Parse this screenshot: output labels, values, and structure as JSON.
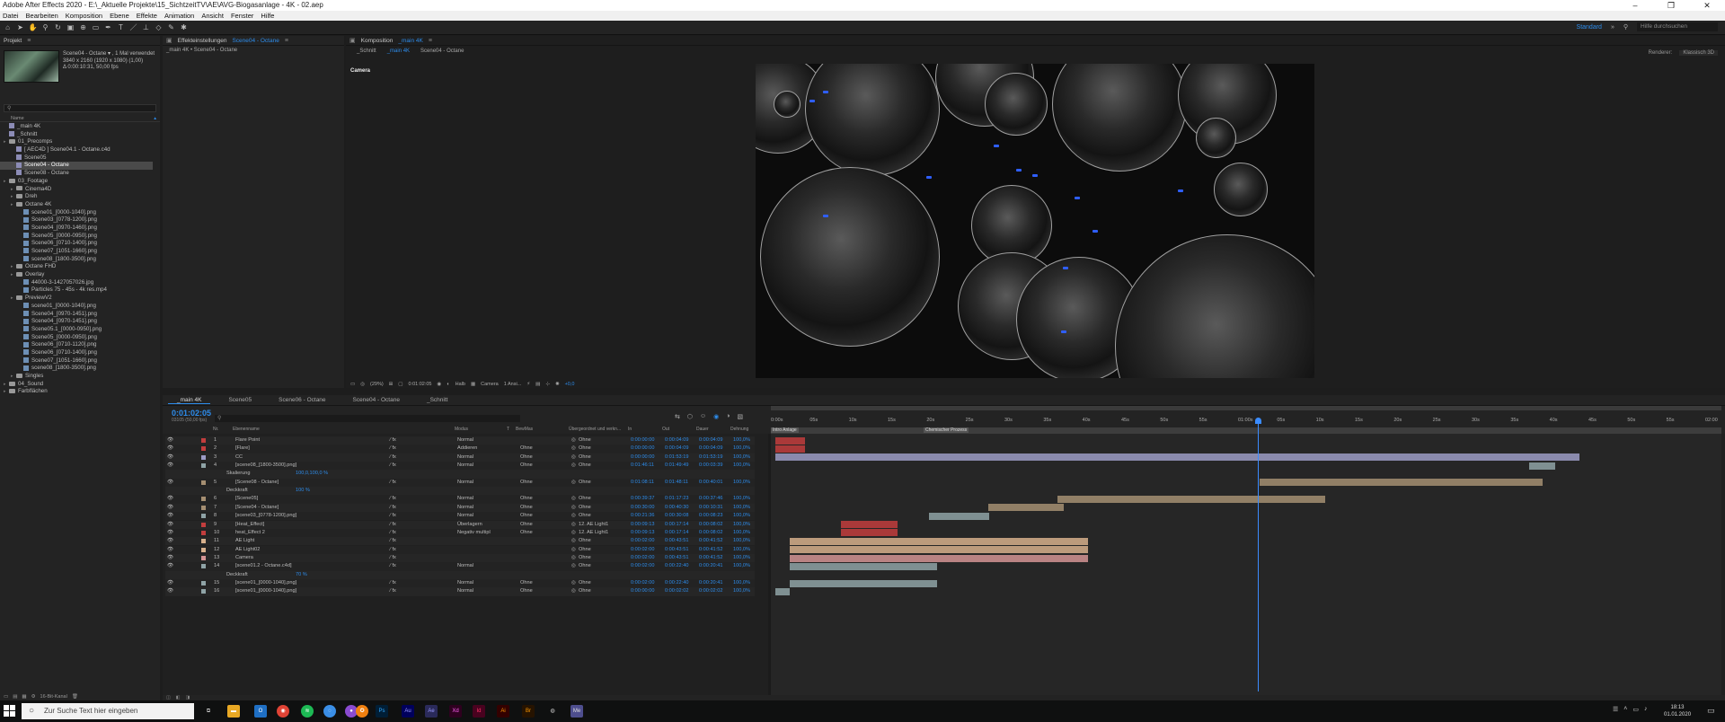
{
  "window": {
    "title": "Adobe After Effects 2020 - E:\\_Aktuelle Projekte\\15_SichtzeitTV\\AE\\AVG-Biogasanlage - 4K - 02.aep",
    "controls": [
      "–",
      "❐",
      "✕"
    ]
  },
  "menu": [
    "Datei",
    "Bearbeiten",
    "Komposition",
    "Ebene",
    "Effekte",
    "Animation",
    "Ansicht",
    "Fenster",
    "Hilfe"
  ],
  "toolbar": {
    "workspace_active": "Standard",
    "search_help": "Hilfe durchsuchen"
  },
  "project": {
    "tab": "Projekt",
    "preview_name": "Scene04 - Octane",
    "preview_used": ", 1 Mal verwendet",
    "preview_info1": "3840 x 2160 (1920 x 1080) (1,00)",
    "preview_info2": "Δ 0:00:10:31, 50,00 fps",
    "col_name": "Name",
    "items": [
      {
        "label": "_main 4K",
        "type": "comp",
        "indent": 0
      },
      {
        "label": "_Schnitt",
        "type": "comp",
        "indent": 0
      },
      {
        "label": "01_Precomps",
        "type": "folder",
        "indent": 0
      },
      {
        "label": "[ AEC4D ] Scene04.1 - Octane.c4d",
        "type": "comp",
        "indent": 1
      },
      {
        "label": "Scene05",
        "type": "comp",
        "indent": 1
      },
      {
        "label": "Scene04 - Octane",
        "type": "comp",
        "indent": 1,
        "selected": true
      },
      {
        "label": "Scene08 - Octane",
        "type": "comp",
        "indent": 1
      },
      {
        "label": "03_Footage",
        "type": "folder",
        "indent": 0
      },
      {
        "label": "Cinema4D",
        "type": "folder",
        "indent": 1
      },
      {
        "label": "Dreh",
        "type": "folder",
        "indent": 1
      },
      {
        "label": "Octane 4K",
        "type": "folder",
        "indent": 1
      },
      {
        "label": "scene01_[0000-1040].png",
        "type": "file",
        "indent": 2
      },
      {
        "label": "Scene03_[0778-1200].png",
        "type": "file",
        "indent": 2
      },
      {
        "label": "Scene04_[0970-1460].png",
        "type": "file",
        "indent": 2
      },
      {
        "label": "Scene05_[0000-0950].png",
        "type": "file",
        "indent": 2
      },
      {
        "label": "Scene06_[0710-1400].png",
        "type": "file",
        "indent": 2
      },
      {
        "label": "Scene07_[1051-1660].png",
        "type": "file",
        "indent": 2
      },
      {
        "label": "scene08_[1800-3500].png",
        "type": "file",
        "indent": 2
      },
      {
        "label": "Octane FHD",
        "type": "folder",
        "indent": 1
      },
      {
        "label": "Overlay",
        "type": "folder",
        "indent": 1
      },
      {
        "label": "44000-3-1427057026.jpg",
        "type": "file",
        "indent": 2
      },
      {
        "label": "Particles 75 - 45s - 4k res.mp4",
        "type": "file",
        "indent": 2
      },
      {
        "label": "PreviewV2",
        "type": "folder",
        "indent": 1
      },
      {
        "label": "scene01_[0000-1040].png",
        "type": "file",
        "indent": 2
      },
      {
        "label": "Scene04_[0970-1451].png",
        "type": "file",
        "indent": 2
      },
      {
        "label": "Scene04_[0970-1451].png",
        "type": "file",
        "indent": 2
      },
      {
        "label": "Scene05.1_[0000-0950].png",
        "type": "file",
        "indent": 2
      },
      {
        "label": "Scene05_[0000-0950].png",
        "type": "file",
        "indent": 2
      },
      {
        "label": "Scene06_[0710-1120].png",
        "type": "file",
        "indent": 2
      },
      {
        "label": "Scene06_[0710-1400].png",
        "type": "file",
        "indent": 2
      },
      {
        "label": "Scene07_[1051-1660].png",
        "type": "file",
        "indent": 2
      },
      {
        "label": "scene08_[1800-3500].png",
        "type": "file",
        "indent": 2
      },
      {
        "label": "Singles",
        "type": "folder",
        "indent": 1
      },
      {
        "label": "04_Sound",
        "type": "folder",
        "indent": 0
      },
      {
        "label": "Farbflächen",
        "type": "folder",
        "indent": 0
      }
    ],
    "bit_depth": "16-Bit-Kanal"
  },
  "effects": {
    "tab_label": "Effekteinstellungen",
    "tab_target": "Scene04 - Octane",
    "breadcrumb": "_main 4K • Scene04 - Octane"
  },
  "composition": {
    "tab_label": "Komposition",
    "tab_target": "_main 4K",
    "subtabs": [
      "_Schnitt",
      "_main 4K",
      "Scene04 - Octane"
    ],
    "renderer_label": "Renderer:",
    "renderer_value": "Klassisch 3D",
    "camera_label": "Camera",
    "footer": {
      "zoom": "(29%)",
      "time": "0:01:02:05",
      "quality": "Halb",
      "camera": "Camera",
      "views": "1 Ansi...",
      "offset": "+0,0"
    }
  },
  "timeline": {
    "tabs": [
      "_main 4K",
      "Scene05",
      "Scene06 - Octane",
      "Scene04 - Octane",
      "_Schnitt"
    ],
    "current_time": "0:01:02:05",
    "current_frames": "03105 (50,00 fps)",
    "headers": {
      "nr": "Nr.",
      "name": "Ebenenname",
      "mode": "Modus",
      "t": "T",
      "trkmat": "BewMas",
      "parent": "Übergeordnet und verkn...",
      "in": "In",
      "out": "Out",
      "dur": "Dauer",
      "stretch": "Dehnung"
    },
    "ruler": [
      "0:00s",
      "05s",
      "10s",
      "15s",
      "20s",
      "25s",
      "30s",
      "35s",
      "40s",
      "45s",
      "50s",
      "55s",
      "01:00s",
      "05s",
      "10s",
      "15s",
      "20s",
      "25s",
      "30s",
      "35s",
      "40s",
      "45s",
      "50s",
      "55s",
      "02:00"
    ],
    "markers": [
      "Intro Anlage",
      "Chemischer Prozess"
    ],
    "layers": [
      {
        "nr": "1",
        "name": "Flare Point",
        "mode": "Normal",
        "trk": "",
        "parent": "Ohne",
        "in": "0:00:00:00",
        "out": "0:00:04:09",
        "dur": "0:00:04:09",
        "st": "100,0%",
        "color": "#c23d3d"
      },
      {
        "nr": "2",
        "name": "[Flare]",
        "mode": "Addieren",
        "trk": "Ohne",
        "parent": "Ohne",
        "in": "0:00:00:00",
        "out": "0:00:04:09",
        "dur": "0:00:04:09",
        "st": "100,0%",
        "color": "#c23d3d"
      },
      {
        "nr": "3",
        "name": "CC",
        "mode": "Normal",
        "trk": "Ohne",
        "parent": "Ohne",
        "in": "0:00:00:00",
        "out": "0:01:53:19",
        "dur": "0:01:53:19",
        "st": "100,0%",
        "color": "#9c9cc6"
      },
      {
        "nr": "4",
        "name": "[scene08_[1800-3500].png]",
        "mode": "Normal",
        "trk": "Ohne",
        "parent": "Ohne",
        "in": "0:01:46:11",
        "out": "0:01:49:49",
        "dur": "0:00:03:39",
        "st": "100,0%",
        "color": "#8fa3a6"
      },
      {
        "nr": "",
        "name": "Skalierung",
        "value": "100,0,100,0 %",
        "prop": true
      },
      {
        "nr": "5",
        "name": "[Scene08 - Octane]",
        "mode": "Normal",
        "trk": "Ohne",
        "parent": "Ohne",
        "in": "0:01:08:11",
        "out": "0:01:48:11",
        "dur": "0:00:40:01",
        "st": "100,0%",
        "color": "#a58f72"
      },
      {
        "nr": "",
        "name": "Deckkraft",
        "value": "100 %",
        "prop": true
      },
      {
        "nr": "6",
        "name": "[Scene05]",
        "mode": "Normal",
        "trk": "Ohne",
        "parent": "Ohne",
        "in": "0:00:39:37",
        "out": "0:01:17:23",
        "dur": "0:00:37:46",
        "st": "100,0%",
        "color": "#a58f72"
      },
      {
        "nr": "7",
        "name": "[Scene04 - Octane]",
        "mode": "Normal",
        "trk": "Ohne",
        "parent": "Ohne",
        "in": "0:00:30:00",
        "out": "0:00:40:30",
        "dur": "0:00:10:31",
        "st": "100,0%",
        "color": "#a58f72"
      },
      {
        "nr": "8",
        "name": "[scene03_[0778-1200].png]",
        "mode": "Normal",
        "trk": "Ohne",
        "parent": "Ohne",
        "in": "0:00:21:36",
        "out": "0:00:30:08",
        "dur": "0:00:08:23",
        "st": "100,0%",
        "color": "#8fa3a6"
      },
      {
        "nr": "9",
        "name": "[Heat_Effect]",
        "mode": "Überlagern",
        "trk": "Ohne",
        "parent": "12. AE Light1",
        "in": "0:00:09:13",
        "out": "0:00:17:14",
        "dur": "0:00:08:02",
        "st": "100,0%",
        "color": "#c23d3d"
      },
      {
        "nr": "10",
        "name": "heat_Effect 2",
        "mode": "Negativ multipl",
        "trk": "Ohne",
        "parent": "12. AE Light1",
        "in": "0:00:09:13",
        "out": "0:00:17:14",
        "dur": "0:00:08:02",
        "st": "100,0%",
        "color": "#c23d3d"
      },
      {
        "nr": "11",
        "name": "AE Light",
        "mode": "",
        "trk": "",
        "parent": "Ohne",
        "in": "0:00:02:00",
        "out": "0:00:43:51",
        "dur": "0:00:41:52",
        "st": "100,0%",
        "color": "#d7b08c"
      },
      {
        "nr": "12",
        "name": "AE Light02",
        "mode": "",
        "trk": "",
        "parent": "Ohne",
        "in": "0:00:02:00",
        "out": "0:00:43:51",
        "dur": "0:00:41:52",
        "st": "100,0%",
        "color": "#d7b08c"
      },
      {
        "nr": "13",
        "name": "Camera",
        "mode": "",
        "trk": "",
        "parent": "Ohne",
        "in": "0:00:02:00",
        "out": "0:00:43:51",
        "dur": "0:00:41:52",
        "st": "100,0%",
        "color": "#d49494"
      },
      {
        "nr": "14",
        "name": "[scene01.2 - Octane.c4d]",
        "mode": "Normal",
        "trk": "",
        "parent": "Ohne",
        "in": "0:00:02:00",
        "out": "0:00:22:40",
        "dur": "0:00:20:41",
        "st": "100,0%",
        "color": "#8fa3a6"
      },
      {
        "nr": "",
        "name": "Deckkraft",
        "value": "70 %",
        "prop": true
      },
      {
        "nr": "15",
        "name": "[scene01_[0000-1040].png]",
        "mode": "Normal",
        "trk": "Ohne",
        "parent": "Ohne",
        "in": "0:00:02:00",
        "out": "0:00:22:40",
        "dur": "0:00:20:41",
        "st": "100,0%",
        "color": "#8fa3a6"
      },
      {
        "nr": "16",
        "name": "[scene01_[0000-1040].png]",
        "mode": "Normal",
        "trk": "Ohne",
        "parent": "Ohne",
        "in": "0:00:00:00",
        "out": "0:00:02:02",
        "dur": "0:00:02:02",
        "st": "100,0%",
        "color": "#8fa3a6"
      }
    ]
  },
  "taskbar": {
    "search_placeholder": "Zur Suche Text hier eingeben",
    "time": "18:13",
    "date": "01.01.2020"
  },
  "colors": {
    "accent": "#2d8ceb",
    "playhead": "#3b8cff"
  }
}
